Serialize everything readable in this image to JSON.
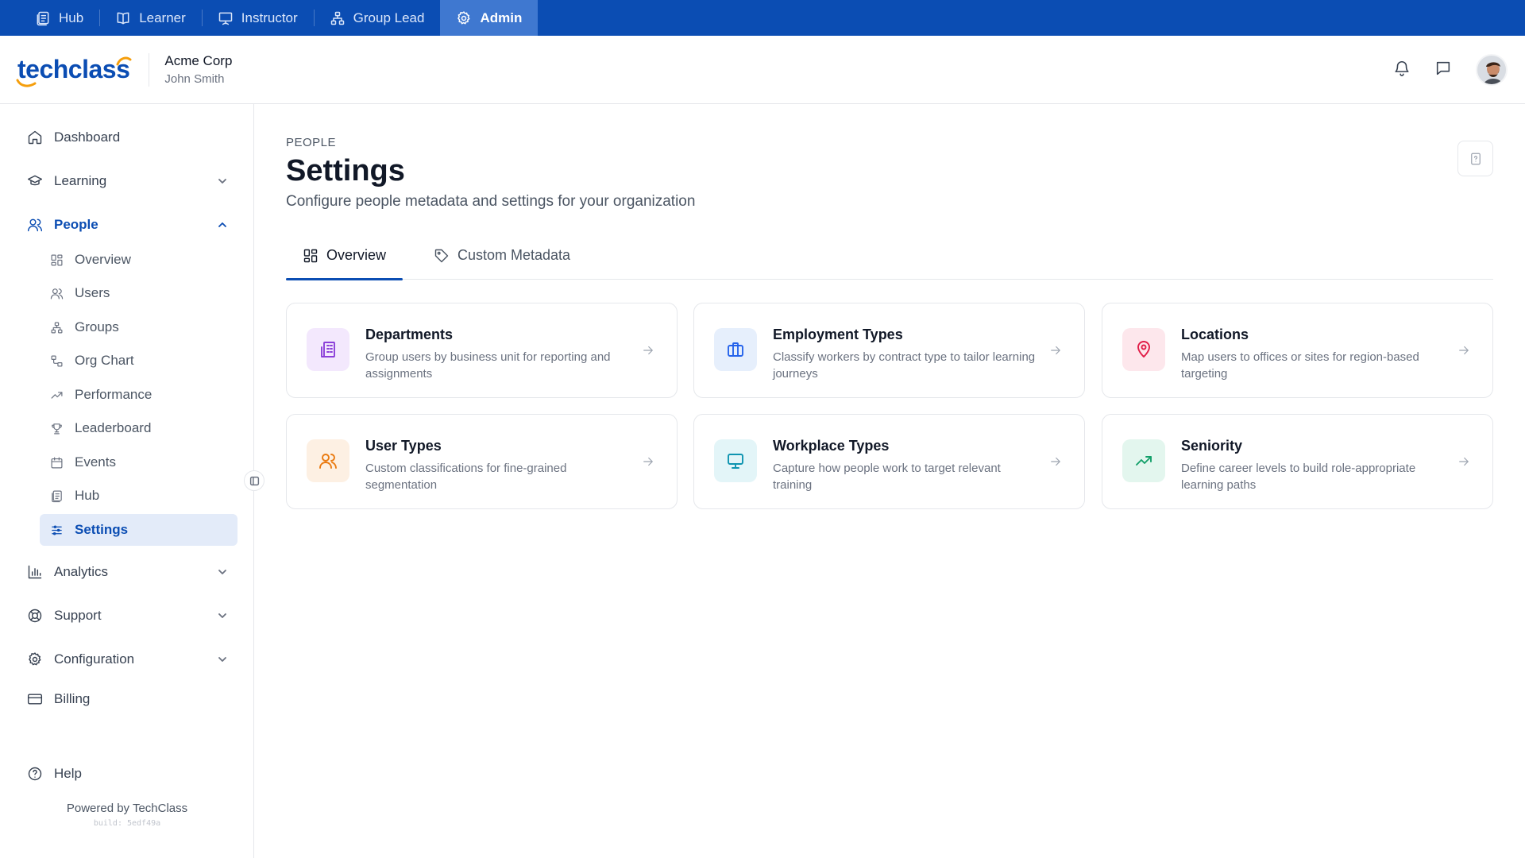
{
  "roles": [
    {
      "label": "Hub",
      "icon": "hub-icon",
      "active": false
    },
    {
      "label": "Learner",
      "icon": "book-icon",
      "active": false
    },
    {
      "label": "Instructor",
      "icon": "presentation-icon",
      "active": false
    },
    {
      "label": "Group Lead",
      "icon": "org-tree-icon",
      "active": false
    },
    {
      "label": "Admin",
      "icon": "gear-icon",
      "active": true
    }
  ],
  "header": {
    "logo_text": "techclass",
    "org_name": "Acme Corp",
    "user_name": "John Smith"
  },
  "sidebar": {
    "items": {
      "dashboard": "Dashboard",
      "learning": "Learning",
      "people": "People",
      "analytics": "Analytics",
      "support": "Support",
      "configuration": "Configuration",
      "billing": "Billing",
      "help": "Help"
    },
    "people_sub": {
      "overview": "Overview",
      "users": "Users",
      "groups": "Groups",
      "org_chart": "Org Chart",
      "performance": "Performance",
      "leaderboard": "Leaderboard",
      "events": "Events",
      "hub": "Hub",
      "settings": "Settings"
    },
    "powered_by": "Powered by TechClass",
    "build": "build: 5edf49a"
  },
  "page": {
    "eyebrow": "PEOPLE",
    "title": "Settings",
    "subtitle": "Configure people metadata and settings for your organization"
  },
  "tabs": {
    "overview": "Overview",
    "custom_metadata": "Custom Metadata"
  },
  "cards": [
    {
      "title": "Departments",
      "desc": "Group users by business unit for reporting and assignments",
      "icon": "building-icon",
      "bg": "#f3e8fd",
      "color": "#8b3fd9"
    },
    {
      "title": "Employment Types",
      "desc": "Classify workers by contract type to tailor learning journeys",
      "icon": "briefcase-icon",
      "bg": "#e6effc",
      "color": "#2563eb"
    },
    {
      "title": "Locations",
      "desc": "Map users to offices or sites for region-based targeting",
      "icon": "map-pin-icon",
      "bg": "#fde7ec",
      "color": "#e11d48"
    },
    {
      "title": "User Types",
      "desc": "Custom classifications for fine-grained segmentation",
      "icon": "users-icon",
      "bg": "#fdf0e3",
      "color": "#ea7a10"
    },
    {
      "title": "Workplace Types",
      "desc": "Capture how people work to target relevant training",
      "icon": "monitor-icon",
      "bg": "#e3f5f8",
      "color": "#0e94b0"
    },
    {
      "title": "Seniority",
      "desc": "Define career levels to build role-appropriate learning paths",
      "icon": "trending-up-icon",
      "bg": "#e3f6ee",
      "color": "#14a06a"
    }
  ],
  "colors": {
    "primary": "#0b4db3",
    "rolebar_active": "#3f78d0",
    "sidebar_active_bg": "#e3ebf9"
  }
}
